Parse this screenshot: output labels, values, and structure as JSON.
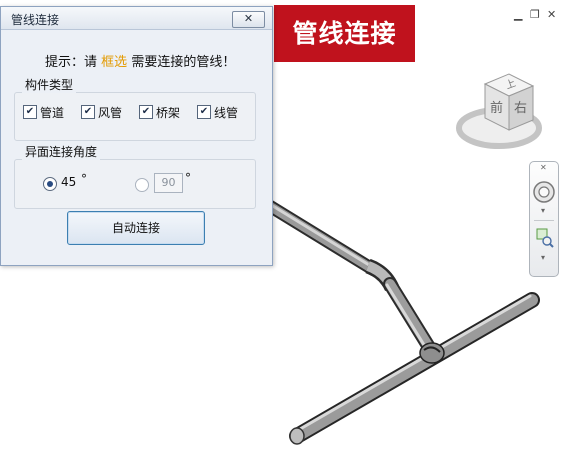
{
  "dialog": {
    "title": "管线连接",
    "close_label": "✕",
    "hint": {
      "prefix": "提示：请",
      "highlight": "框选",
      "suffix": "需要连接的管线！"
    },
    "component_group": {
      "legend": "构件类型",
      "items": [
        {
          "label": "管道",
          "checked": true
        },
        {
          "label": "风管",
          "checked": true
        },
        {
          "label": "桥架",
          "checked": true
        },
        {
          "label": "线管",
          "checked": true
        }
      ]
    },
    "angle_group": {
      "legend": "异面连接角度",
      "option_45": "45",
      "degree_symbol": "°",
      "option_90_value": "90"
    },
    "auto_connect_label": "自动连接"
  },
  "banner": {
    "text": "管线连接"
  },
  "viewcube": {
    "face_front": "前",
    "face_right": "右",
    "face_top": "上"
  },
  "colors": {
    "banner_bg": "#c0121d",
    "highlight": "#e39a00",
    "dialog_bg": "#ecf0f6"
  }
}
